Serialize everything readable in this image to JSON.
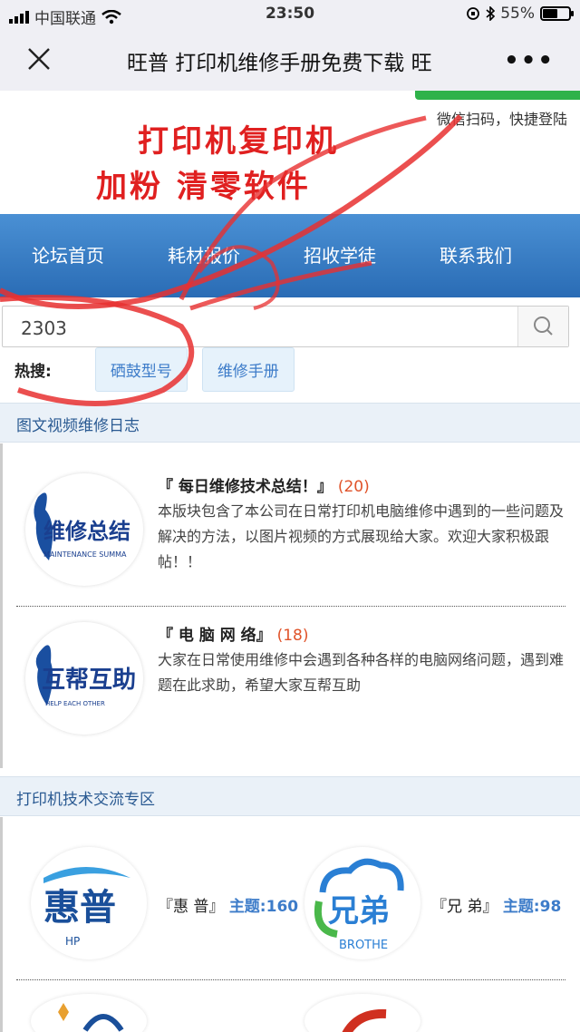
{
  "status": {
    "carrier": "中国联通",
    "time": "23:50",
    "battery": "55%"
  },
  "navbar": {
    "title": "旺普 打印机维修手册免费下载 旺"
  },
  "banner": {
    "line1": "打印机复印机",
    "line2": "加粉 清零软件",
    "login_tip": "微信扫码，快捷登陆"
  },
  "menu": [
    "论坛首页",
    "耗材报价",
    "招收学徒",
    "联系我们"
  ],
  "search": {
    "value": "2303"
  },
  "hot": {
    "label": "热搜:",
    "tags": [
      "硒鼓型号",
      "维修手册"
    ]
  },
  "sections": [
    {
      "title": "图文视频维修日志",
      "forums": [
        {
          "name": "『 每日维修技术总结！』",
          "count": "(20)",
          "desc": "本版块包含了本公司在日常打印机电脑维修中遇到的一些问题及解决的方法，以图片视频的方式展现给大家。欢迎大家积极跟帖！！",
          "logo_text": "维修总结",
          "logo_sub": "MAINTENANCE SUMMA"
        },
        {
          "name": "『 电 脑 网 络』",
          "count": "(18)",
          "desc": "大家在日常使用维修中会遇到各种各样的电脑网络问题，遇到难题在此求助，希望大家互帮互助",
          "logo_text": "互帮互助",
          "logo_sub": "HELP EACH OTHER"
        }
      ]
    },
    {
      "title": "打印机技术交流专区",
      "items": [
        {
          "name": "『惠 普』",
          "sub": "主题:160",
          "logo_text": "惠普",
          "logo_sub": "HP"
        },
        {
          "name": "『兄 弟』",
          "sub": "主题:98",
          "logo_text": "兄弟",
          "logo_sub": "BROTHE"
        }
      ]
    }
  ],
  "colors": {
    "accent": "#2a6cb5",
    "banner_red": "#e02020",
    "count": "#e0532a"
  }
}
